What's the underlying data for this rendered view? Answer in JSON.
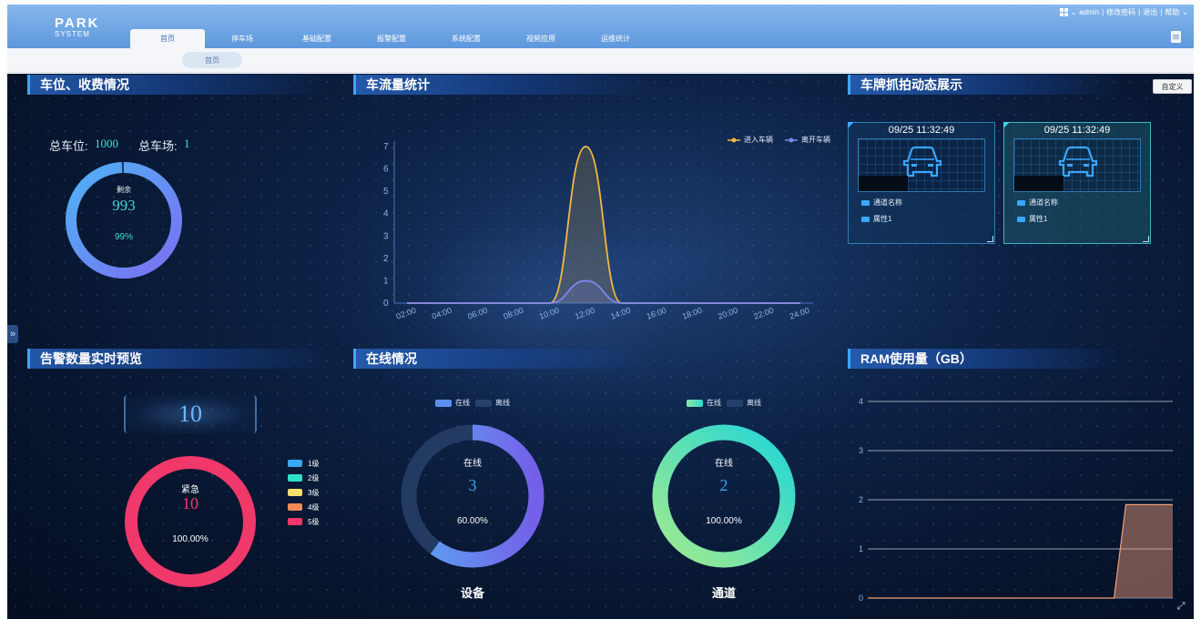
{
  "header": {
    "logo_line1": "PARK",
    "logo_line2": "SYSTEM",
    "tabs": [
      "首页",
      "停车场",
      "基础配置",
      "报警配置",
      "系统配置",
      "视频应用",
      "运维统计"
    ],
    "user": "admin",
    "links": [
      "修改密码",
      "退出",
      "帮助"
    ]
  },
  "breadcrumb": "首页",
  "panels": {
    "parking": {
      "title": "车位、收费情况",
      "total_spaces_label": "总车位:",
      "total_spaces_value": "1000",
      "total_lots_label": "总车场:",
      "total_lots_value": "1",
      "ring_label": "剩余",
      "ring_value": "993",
      "ring_percent": "99%",
      "remaining_fraction": 0.993
    },
    "traffic": {
      "title": "车流量统计",
      "legend_in": "进入车辆",
      "legend_out": "离开车辆"
    },
    "capture": {
      "title": "车牌抓拍动态展示",
      "customize_label": "自定义",
      "cards": [
        {
          "time": "09/25 11:32:49",
          "channel_label": "通道名称",
          "attr_label": "属性1"
        },
        {
          "time": "09/25 11:32:49",
          "channel_label": "通道名称",
          "attr_label": "属性1"
        }
      ]
    },
    "alarm": {
      "title": "告警数量实时预览",
      "total": "10",
      "ring_label": "紧急",
      "ring_value": "10",
      "ring_percent": "100.00%",
      "levels": [
        "1级",
        "2级",
        "3级",
        "4级",
        "5级"
      ],
      "level_colors": [
        "#3aa8f0",
        "#2fe0c8",
        "#f7df6e",
        "#f28a56",
        "#f0386a"
      ]
    },
    "online": {
      "title": "在线情况",
      "legend_online": "在线",
      "legend_offline": "离线",
      "device": {
        "label": "在线",
        "value": "3",
        "percent": "60.00%",
        "caption": "设备",
        "fraction": 0.6
      },
      "channel": {
        "label": "在线",
        "value": "2",
        "percent": "100.00%",
        "caption": "通道",
        "fraction": 1.0
      }
    },
    "ram": {
      "title": "RAM使用量（GB）"
    }
  },
  "chart_data": [
    {
      "type": "area",
      "title": "车流量统计",
      "x": [
        "02:00",
        "04:00",
        "06:00",
        "08:00",
        "10:00",
        "12:00",
        "14:00",
        "16:00",
        "18:00",
        "20:00",
        "22:00",
        "24:00"
      ],
      "series": [
        {
          "name": "进入车辆",
          "values": [
            0,
            0,
            0,
            0,
            0,
            7,
            0,
            0,
            0,
            0,
            0,
            0
          ],
          "color": "#f3b844"
        },
        {
          "name": "离开车辆",
          "values": [
            0,
            0,
            0,
            0,
            0,
            1,
            0,
            0,
            0,
            0,
            0,
            0
          ],
          "color": "#7d86f0"
        }
      ],
      "yticks": [
        "0",
        "1",
        "2",
        "3",
        "4",
        "5",
        "6",
        "7"
      ],
      "ylim": [
        0,
        7
      ]
    },
    {
      "type": "area",
      "title": "RAM使用量（GB）",
      "yticks": [
        "0",
        "1",
        "2",
        "3",
        "4"
      ],
      "ylim": [
        0,
        4
      ],
      "series": [
        {
          "values": [
            0,
            0,
            0,
            0,
            0,
            0,
            0,
            0,
            0,
            0,
            0,
            0,
            0,
            0,
            0,
            0,
            0,
            0,
            0,
            0,
            0,
            0,
            1.9,
            1.9,
            1.9,
            1.9,
            1.9
          ],
          "color": "#f3a07a"
        }
      ]
    }
  ]
}
